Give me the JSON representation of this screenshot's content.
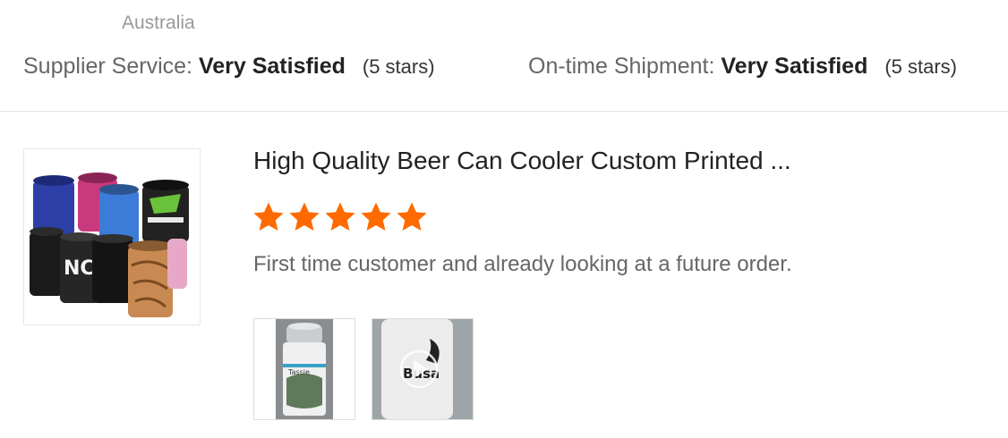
{
  "reviewer": {
    "country": "Australia"
  },
  "ratings": {
    "supplier_service": {
      "label": "Supplier Service:",
      "value": "Very Satisfied",
      "stars_text": "(5 stars)"
    },
    "ontime_shipment": {
      "label": "On-time Shipment:",
      "value": "Very Satisfied",
      "stars_text": "(5 stars)"
    }
  },
  "review": {
    "product_title": "High Quality Beer Can Cooler Custom Printed ...",
    "rating": 5,
    "star_color": "#ff6a00",
    "text": "First time customer and already looking at a future order.",
    "photo_count": 2,
    "video_thumbnail": true
  }
}
